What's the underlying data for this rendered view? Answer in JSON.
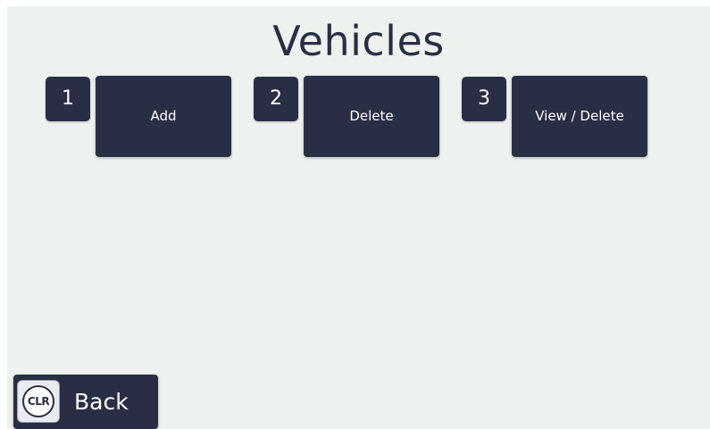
{
  "title": "Vehicles",
  "menu": [
    {
      "number": "1",
      "label": "Add"
    },
    {
      "number": "2",
      "label": "Delete"
    },
    {
      "number": "3",
      "label": "View / Delete"
    }
  ],
  "back": {
    "icon_text": "CLR",
    "label": "Back"
  },
  "colors": {
    "background": "#eef2ef",
    "button": "#2a2e45",
    "text": "#ffffff"
  }
}
